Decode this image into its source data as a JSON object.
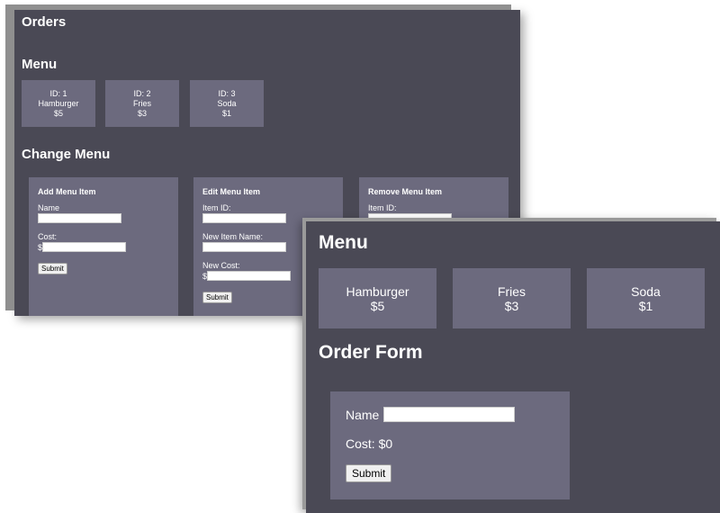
{
  "admin": {
    "title": "Orders",
    "menu_heading": "Menu",
    "menu_items": [
      {
        "id": "ID: 1",
        "name": "Hamburger",
        "price": "$5"
      },
      {
        "id": "ID: 2",
        "name": "Fries",
        "price": "$3"
      },
      {
        "id": "ID: 3",
        "name": "Soda",
        "price": "$1"
      }
    ],
    "change_heading": "Change Menu",
    "add_form": {
      "title": "Add Menu Item",
      "name_label": "Name",
      "cost_label": "Cost:",
      "currency": "$",
      "submit": "Submit"
    },
    "edit_form": {
      "title": "Edit Menu Item",
      "id_label": "Item ID:",
      "new_name_label": "New Item Name:",
      "new_cost_label": "New Cost:",
      "currency": "$",
      "submit": "Submit"
    },
    "remove_form": {
      "title": "Remove Menu Item",
      "id_label": "Item ID:"
    }
  },
  "order": {
    "menu_heading": "Menu",
    "menu_items": [
      {
        "name": "Hamburger",
        "price": "$5"
      },
      {
        "name": "Fries",
        "price": "$3"
      },
      {
        "name": "Soda",
        "price": "$1"
      }
    ],
    "form_heading": "Order Form",
    "name_label": "Name",
    "cost_text": "Cost: $0",
    "submit": "Submit"
  }
}
